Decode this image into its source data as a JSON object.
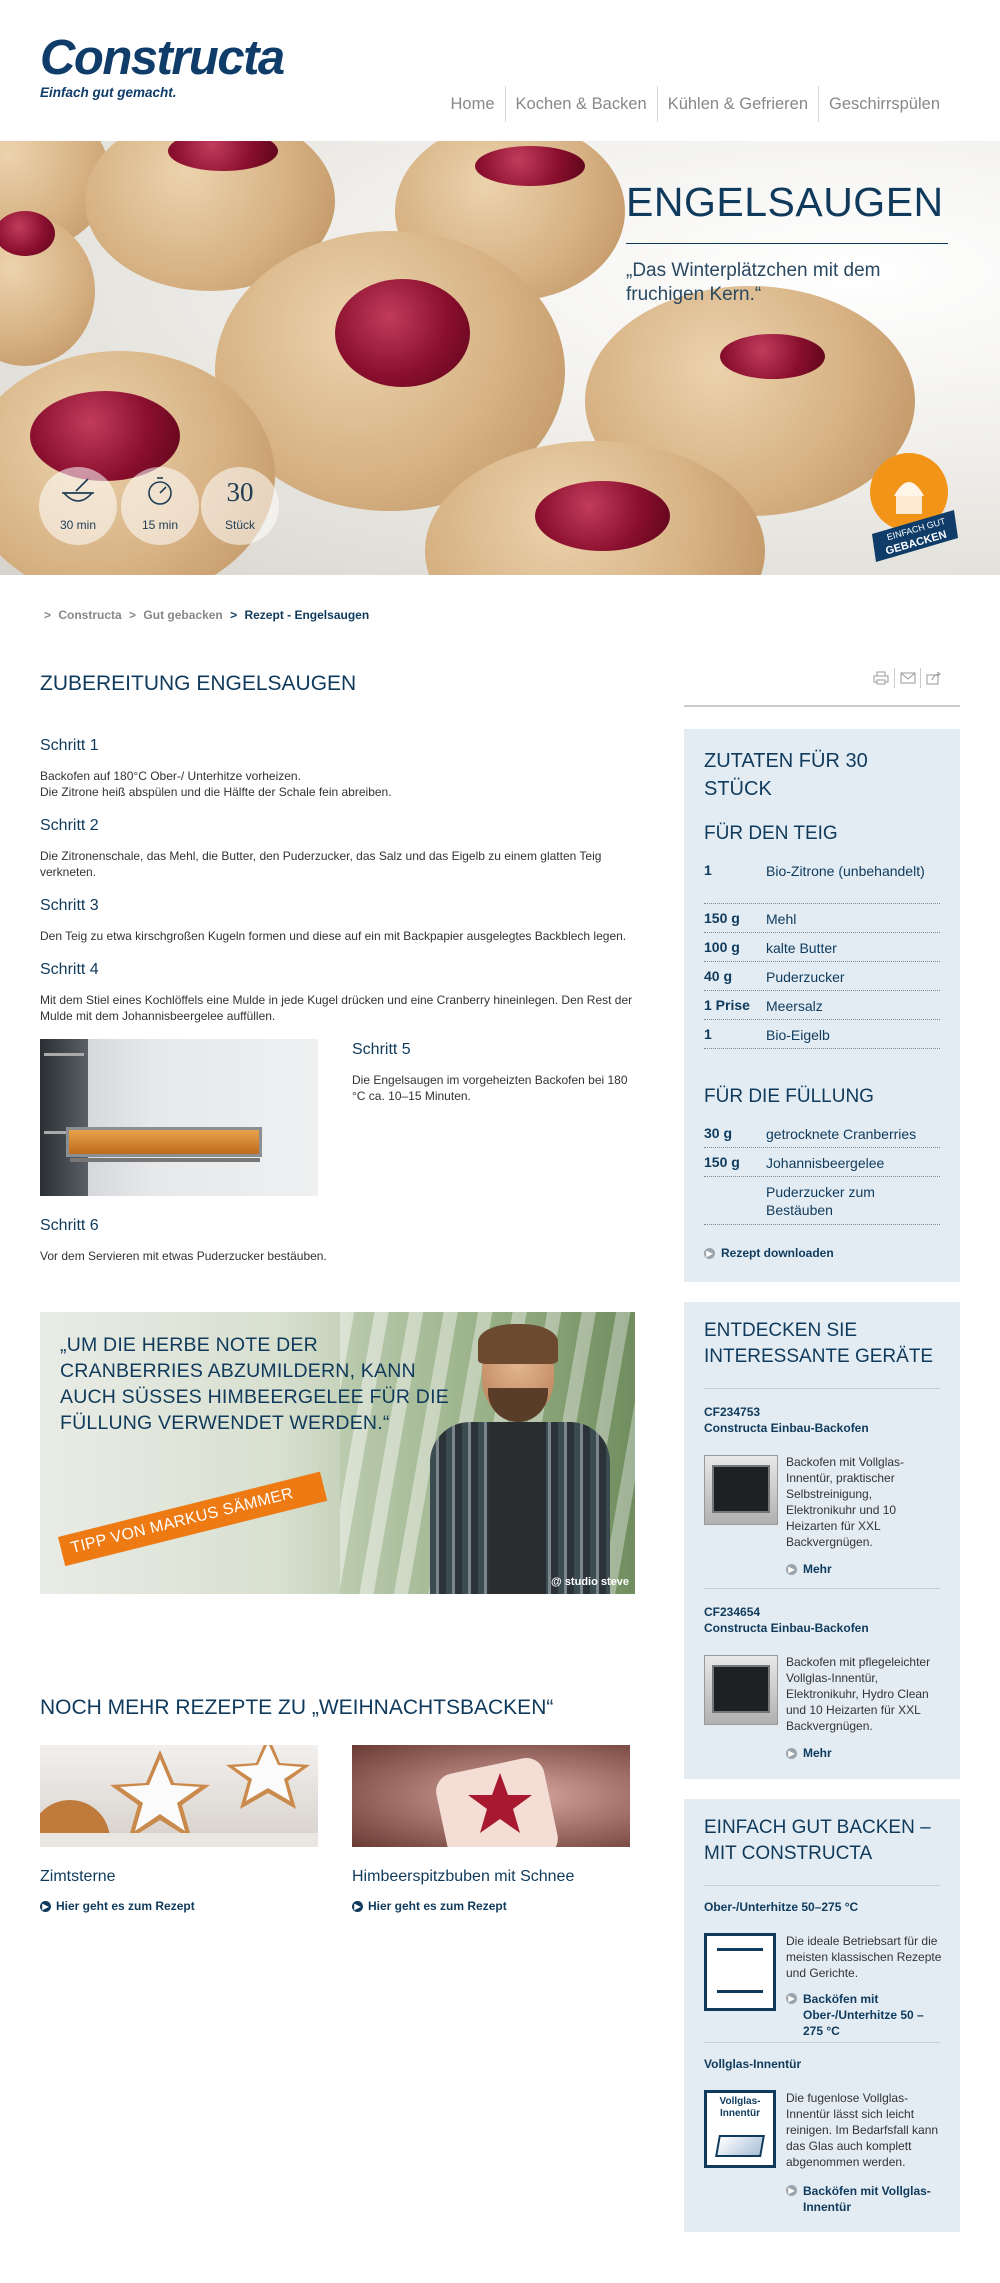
{
  "brand": {
    "logo": "Constructa",
    "tagline": "Einfach gut gemacht."
  },
  "nav": [
    "Home",
    "Kochen & Backen",
    "Kühlen & Gefrieren",
    "Geschirrspülen"
  ],
  "hero": {
    "title": "ENGELSAUGEN",
    "quote": "„Das Winterplätzchen mit dem fruchigen Kern.“",
    "stats": [
      {
        "icon": "bowl-icon",
        "label": "30 min"
      },
      {
        "icon": "timer-icon",
        "label": "15 min"
      },
      {
        "value": "30",
        "label": "Stück"
      }
    ],
    "badge": {
      "line1": "EINFACH GUT",
      "line2": "GEBACKEN"
    }
  },
  "breadcrumb": {
    "sep": ">",
    "items": [
      "Constructa",
      "Gut gebacken"
    ],
    "current": "Rezept - Engelsaugen"
  },
  "preparation": {
    "title": "ZUBEREITUNG ENGELSAUGEN",
    "steps": [
      {
        "title": "Schritt 1",
        "text": "Backofen auf 180°C Ober-/ Unterhitze vorheizen.\nDie Zitrone heiß abspülen und die Hälfte der Schale fein abreiben."
      },
      {
        "title": "Schritt 2",
        "text": "Die Zitronenschale, das Mehl, die Butter, den Puderzucker, das Salz und das Eigelb zu einem glatten Teig verkneten."
      },
      {
        "title": "Schritt 3",
        "text": "Den Teig zu etwa kirschgroßen Kugeln formen und diese auf ein mit Backpapier ausgelegtes Backblech legen."
      },
      {
        "title": "Schritt 4",
        "text": "Mit dem Stiel eines Kochlöffels eine Mulde in jede Kugel drücken und eine Cranberry hineinlegen. Den Rest der Mulde mit dem Johannisbeergelee auffüllen."
      },
      {
        "title": "Schritt 5",
        "text": "Die Engelsaugen im vorgeheizten Backofen bei 180 °C ca. 10–15 Minuten."
      },
      {
        "title": "Schritt 6",
        "text": "Vor dem Servieren mit etwas Puderzucker bestäuben."
      }
    ]
  },
  "tip": {
    "quote": "„UM DIE HERBE NOTE DER CRANBERRIES ABZUMILDERN, KANN AUCH SÜSSES HIMBEERGELEE FÜR DIE FÜLLUNG VERWENDET WERDEN.“",
    "ribbon": "TIPP VON MARKUS SÄMMER",
    "credit": "@ studio steve"
  },
  "more_recipes": {
    "title": "NOCH MEHR REZEPTE ZU „WEIHNACHTSBACKEN“",
    "link_label": "Hier geht es zum Rezept",
    "items": [
      {
        "title": "Zimtsterne"
      },
      {
        "title": "Himbeerspitzbuben mit Schnee"
      }
    ]
  },
  "ingredients": {
    "title": "ZUTATEN FÜR 30 STÜCK",
    "dough_title": "FÜR DEN TEIG",
    "dough": [
      {
        "qty": "1",
        "name": "Bio-Zitrone (unbehandelt)"
      },
      {
        "qty": "150 g",
        "name": "Mehl"
      },
      {
        "qty": "100 g",
        "name": "kalte Butter"
      },
      {
        "qty": "40 g",
        "name": "Puderzucker"
      },
      {
        "qty": "1 Prise",
        "name": "Meersalz"
      },
      {
        "qty": "1",
        "name": "Bio-Eigelb"
      }
    ],
    "filling_title": "FÜR DIE FÜLLUNG",
    "filling": [
      {
        "qty": "30 g",
        "name": "getrocknete Cranberries"
      },
      {
        "qty": "150 g",
        "name": "Johannisbeergelee"
      },
      {
        "qty": "",
        "name": "Puderzucker zum Bestäuben"
      }
    ],
    "download": "Rezept downloaden"
  },
  "devices": {
    "title": "ENTDECKEN SIE INTERESSANTE GERÄTE",
    "more_label": "Mehr",
    "items": [
      {
        "code": "CF234753",
        "name": "Constructa Einbau-Backofen",
        "text": "Backofen mit Vollglas-Innentür, praktischer Selbstreinigung, Elektronikuhr und 10 Heizarten für XXL Backvergnügen."
      },
      {
        "code": "CF234654",
        "name": "Constructa Einbau-Backofen",
        "text": "Backofen mit pflegeleichter Vollglas-Innentür, Elektronikuhr, Hydro Clean und 10 Heizarten für XXL Backvergnügen."
      }
    ]
  },
  "baking": {
    "title": "EINFACH GUT BACKEN – MIT CONSTRUCTA",
    "modes": [
      {
        "title": "Ober-/Unterhitze 50–275 °C",
        "text": "Die ideale Betriebsart für die meisten klassischen Rezepte und Gerichte.",
        "link": "Backöfen mit Ober-/Unterhitze 50 –275 °C"
      },
      {
        "title": "Vollglas-Innentür",
        "icon_label": "Vollglas-Innentür",
        "text": "Die fugenlose Vollglas-Innentür lässt sich leicht reinigen. Im Bedarfsfall kann das Glas auch komplett abgenommen werden.",
        "link": "Backöfen mit Vollglas-Innentür"
      }
    ]
  },
  "colors": {
    "brand": "#0f3c69",
    "accent": "#ee7a14",
    "sidebar": "#e3ecf3"
  }
}
